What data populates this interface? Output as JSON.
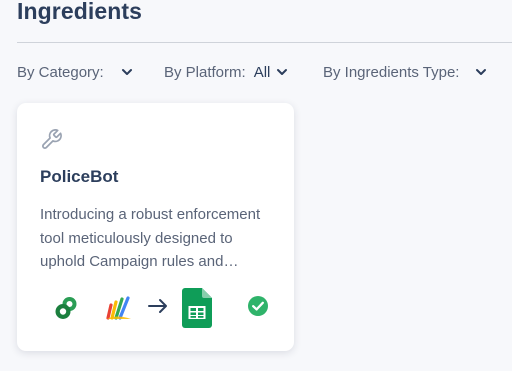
{
  "page": {
    "title": "Ingredients"
  },
  "filters": {
    "category": {
      "label": "By Category:",
      "value": ""
    },
    "platform": {
      "label": "By Platform:",
      "value": "All"
    },
    "ingredients_type": {
      "label": "By Ingredients Type:",
      "value": ""
    }
  },
  "cards": [
    {
      "icon": "wrench-icon",
      "title": "PoliceBot",
      "description": "Introducing a robust enforcement tool meticulously designed to uphold Campaign rules and guidelines.",
      "integrations": [
        "green-link-icon",
        "looker-studio-icon",
        "arrow-right-icon",
        "google-sheets-icon"
      ],
      "status": "check-circle-icon",
      "colors": {
        "status": "#2fb36a",
        "sheets": "#0f9d58",
        "link": "#1e9e4a"
      }
    }
  ]
}
